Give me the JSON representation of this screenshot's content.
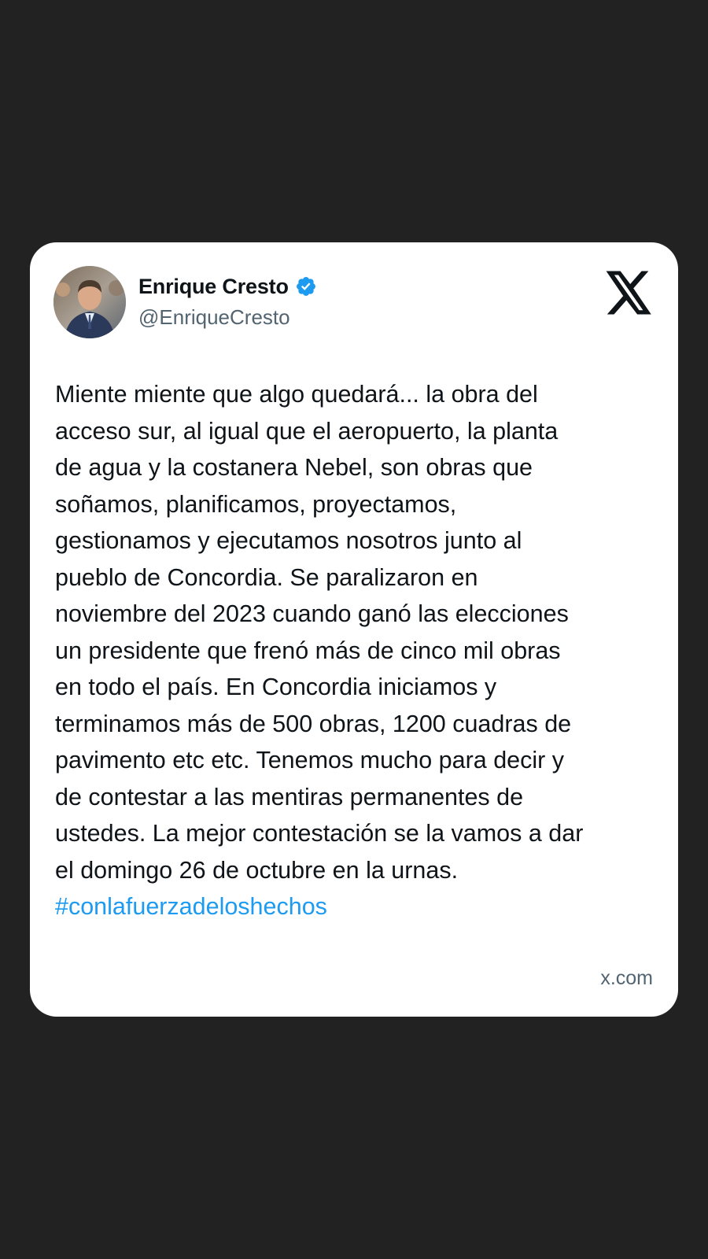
{
  "tweet": {
    "author": {
      "display_name": "Enrique Cresto",
      "handle": "@EnriqueCresto",
      "verified": true
    },
    "platform_icon": "x-logo-icon",
    "body_lines": [
      "Miente miente que algo quedará... la obra del",
      "acceso sur, al igual que el aeropuerto, la planta",
      "de agua y la costanera Nebel, son obras que",
      "soñamos, planificamos, proyectamos,",
      "gestionamos y ejecutamos nosotros junto al",
      "pueblo de Concordia. Se paralizaron en",
      "noviembre del 2023 cuando ganó las elecciones",
      "un presidente que frenó más de cinco mil obras",
      "en todo el país. En Concordia iniciamos y",
      "terminamos más de 500 obras, 1200 cuadras de",
      "pavimento etc etc. Tenemos mucho para decir y",
      "de contestar a las mentiras permanentes de",
      "ustedes. La mejor contestación se la vamos a dar",
      "el domingo 26 de octubre en la urnas."
    ],
    "hashtag": "#conlafuerzadeloshechos",
    "source": "x.com"
  },
  "colors": {
    "background": "#222222",
    "card": "#ffffff",
    "text": "#0f1419",
    "secondary": "#536471",
    "link": "#1d9bf0"
  }
}
